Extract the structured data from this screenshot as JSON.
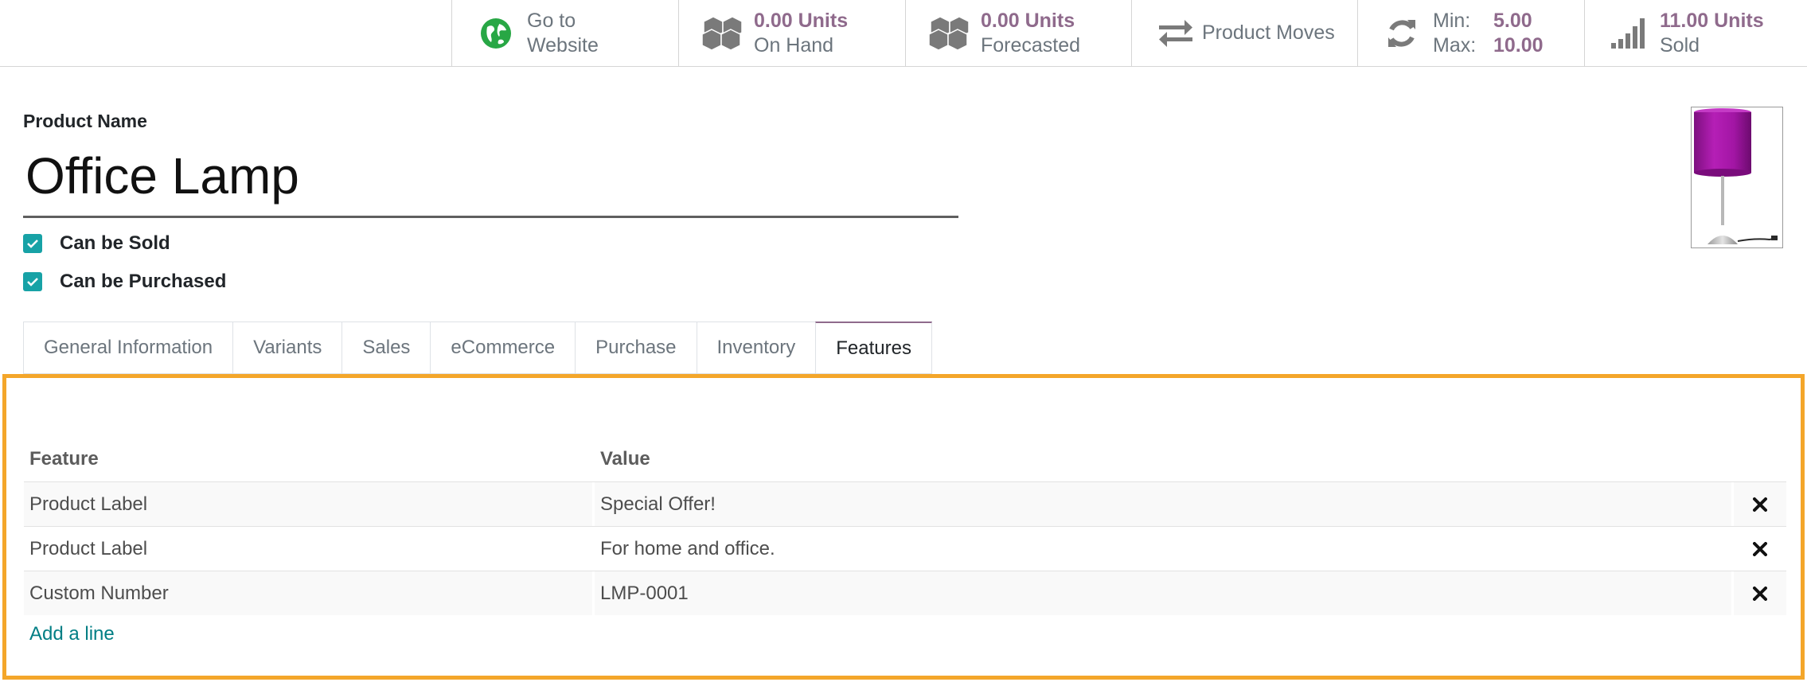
{
  "smart_buttons": {
    "website": {
      "line1": "Go to",
      "line2": "Website",
      "icon": "globe-icon",
      "color": "#28a745"
    },
    "on_hand": {
      "value": "0.00 Units",
      "label": "On Hand",
      "icon": "cubes-icon"
    },
    "forecasted": {
      "value": "0.00 Units",
      "label": "Forecasted",
      "icon": "cubes-icon"
    },
    "product_moves": {
      "label": "Product Moves",
      "icon": "exchange-icon"
    },
    "reordering": {
      "min_label": "Min:",
      "min_value": "5.00",
      "max_label": "Max:",
      "max_value": "10.00",
      "icon": "refresh-icon"
    },
    "sold": {
      "value": "11.00 Units",
      "label": "Sold",
      "icon": "signal-icon"
    }
  },
  "product": {
    "name_label": "Product Name",
    "name": "Office Lamp",
    "can_be_sold_label": "Can be Sold",
    "can_be_sold": true,
    "can_be_purchased_label": "Can be Purchased",
    "can_be_purchased": true,
    "image_icon": "lamp-image"
  },
  "tabs": [
    {
      "label": "General Information",
      "active": false
    },
    {
      "label": "Variants",
      "active": false
    },
    {
      "label": "Sales",
      "active": false
    },
    {
      "label": "eCommerce",
      "active": false
    },
    {
      "label": "Purchase",
      "active": false
    },
    {
      "label": "Inventory",
      "active": false
    },
    {
      "label": "Features",
      "active": true
    }
  ],
  "features": {
    "columns": {
      "feature": "Feature",
      "value": "Value"
    },
    "rows": [
      {
        "feature": "Product Label",
        "value": "Special Offer!"
      },
      {
        "feature": "Product Label",
        "value": "For home and office."
      },
      {
        "feature": "Custom Number",
        "value": "LMP-0001"
      }
    ],
    "add_line_label": "Add a line",
    "delete_icon": "close-icon"
  },
  "colors": {
    "accent": "#8f6a8c",
    "checkbox": "#17a2a6",
    "link": "#017e84",
    "highlight_border": "#f4a62a"
  }
}
